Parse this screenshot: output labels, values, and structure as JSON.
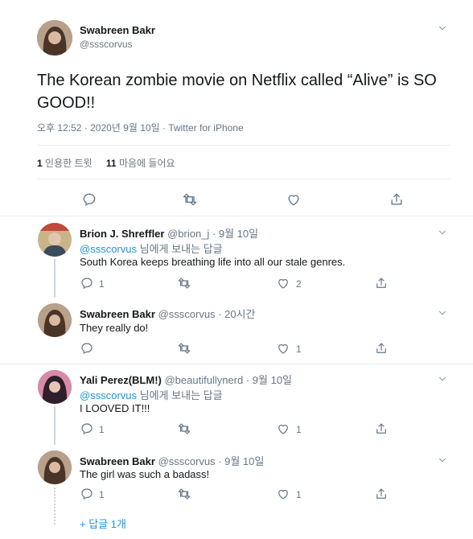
{
  "main_tweet": {
    "name": "Swabreen Bakr",
    "handle": "@ssscorvus",
    "text": "The Korean zombie movie on Netflix called “Alive” is SO GOOD!!",
    "meta": "오후 12:52 · 2020년 9월 10일 · Twitter for iPhone",
    "stats": {
      "quotes_count": "1",
      "quotes_label": "인용한 트윗",
      "likes_count": "11",
      "likes_label": "마음에 들어요"
    }
  },
  "replies": [
    {
      "name": "Brion J. Shreffler",
      "handle_time": "@brion_j · 9월 10일",
      "reply_to_handle": "@ssscorvus",
      "reply_to_suffix": "님에게 보내는 답글",
      "text": "South Korea keeps breathing life into all our stale genres.",
      "reply_count": "1",
      "retweet_count": "",
      "like_count": "2"
    },
    {
      "name": "Swabreen Bakr",
      "handle_time": "@ssscorvus · 20시간",
      "text": "They really do!",
      "reply_count": "",
      "retweet_count": "",
      "like_count": "1"
    },
    {
      "name": "Yali Perez(BLM!)",
      "handle_time": "@beautifullynerd · 9월 10일",
      "reply_to_handle": "@ssscorvus",
      "reply_to_suffix": "님에게 보내는 답글",
      "text": "I LOOVED IT!!!",
      "reply_count": "1",
      "retweet_count": "",
      "like_count": "1"
    },
    {
      "name": "Swabreen Bakr",
      "handle_time": "@ssscorvus · 9월 10일",
      "text": "The girl was such a badass!",
      "reply_count": "1",
      "retweet_count": "",
      "like_count": "1"
    }
  ],
  "more_replies": "+ 답글 1개",
  "icons": {
    "reply": "reply-icon",
    "retweet": "retweet-icon",
    "like": "like-icon",
    "share": "share-icon",
    "more": "chevron-down-icon"
  },
  "colors": {
    "text": "#14171a",
    "muted": "#657786",
    "accent": "#1b95e0",
    "divider": "#e6ecf0"
  }
}
